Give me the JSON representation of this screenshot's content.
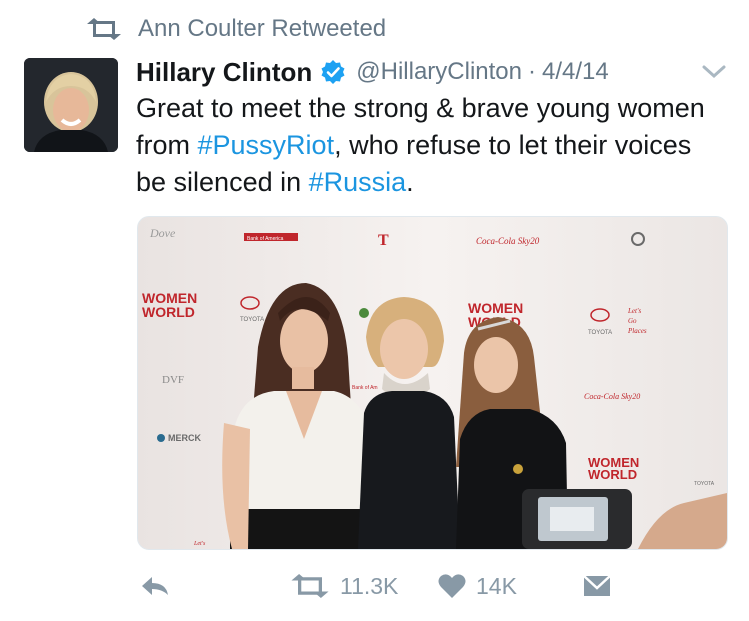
{
  "retweet_context": {
    "text": "Ann Coulter Retweeted",
    "icon": "retweet-icon"
  },
  "tweet": {
    "author_name": "Hillary Clinton",
    "verified_icon": "verified-badge-icon",
    "handle": "@HillaryClinton",
    "separator": "·",
    "date": "4/4/14",
    "text": {
      "part1": "Great to meet the strong & brave young women from ",
      "hashtag1": "#PussyRiot",
      "part2": ", who refuse to let their voices be silenced in ",
      "hashtag2": "#Russia",
      "part3": "."
    },
    "media": {
      "signage": {
        "dove": "Dove",
        "boa": "Bank of America",
        "t": "T",
        "coke1": "Coca-Cola Sky20",
        "women1": "WOMEN",
        "world1": "WORLD",
        "toyota1": "TOYOTA",
        "women2": "WOMEN",
        "world2": "WORLD",
        "toyota2": "TOYOTA",
        "lets": "Let's",
        "go": "Go",
        "places": "Places",
        "dvf": "DVF",
        "merck": "MERCK",
        "boa2": "Bank of Am",
        "coke2": "Coca-Cola Sky20",
        "women3": "WOMEN",
        "world3": "WORLD",
        "toyota3": "TOYOTA",
        "lets2": "Let's"
      }
    }
  },
  "actions": {
    "reply_icon": "reply-icon",
    "retweet_icon": "retweet-icon",
    "retweet_count": "11.3K",
    "like_icon": "heart-icon",
    "like_count": "14K",
    "dm_icon": "envelope-icon"
  },
  "colors": {
    "link": "#1b95e0",
    "secondary": "#657786",
    "action": "#8899a6",
    "verified": "#1da1f2"
  }
}
